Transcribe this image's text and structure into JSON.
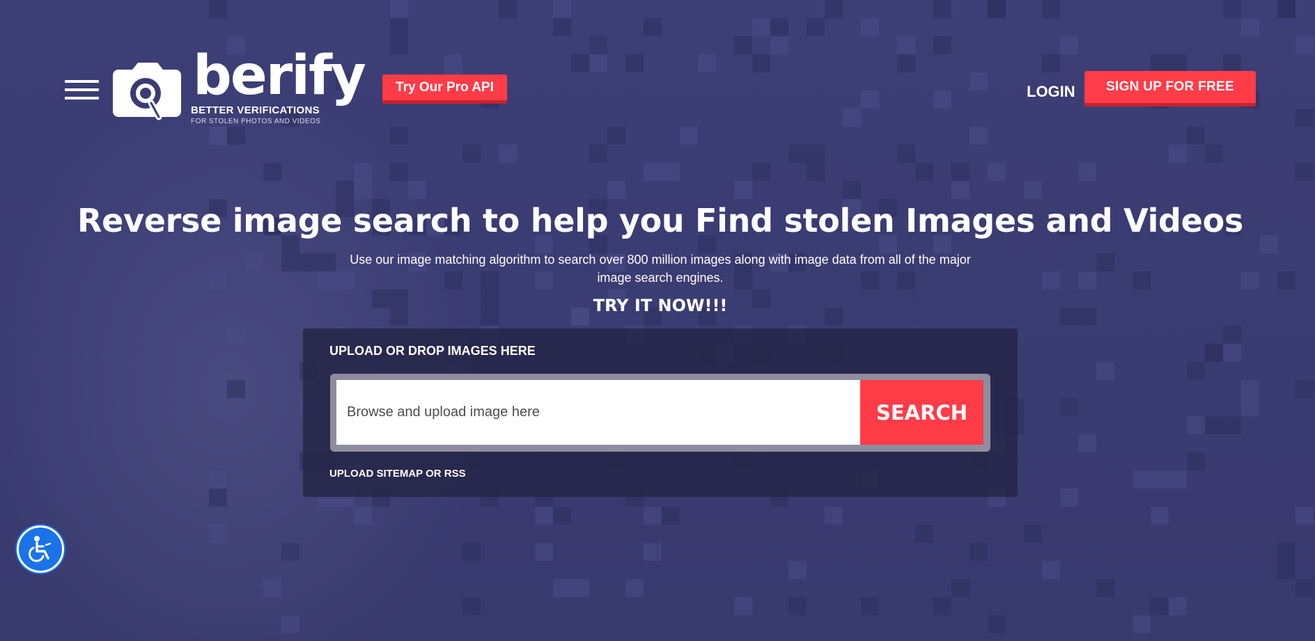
{
  "header": {
    "menu_icon": "hamburger-menu-icon",
    "logo": {
      "wordmark": "berify",
      "tagline": "BETTER VERIFICATIONS",
      "subtagline": "FOR STOLEN PHOTOS AND VIDEOS",
      "icon": "camera-magnifier-icon"
    },
    "api_button": "Try Our Pro API",
    "login": "LOGIN",
    "signup_button": "SIGN UP FOR FREE"
  },
  "hero": {
    "headline": "Reverse image search to help you Find stolen Images and Videos",
    "subtext": "Use our image matching algorithm to search over 800 million images along with image data from all of the major image search engines.",
    "cta": "TRY IT NOW!!!"
  },
  "upload": {
    "title": "UPLOAD OR DROP IMAGES HERE",
    "placeholder": "Browse and upload image here",
    "search_button": "SEARCH",
    "sitemap_link": "UPLOAD SITEMAP OR RSS"
  },
  "accessibility": {
    "icon": "accessibility-wheelchair-icon"
  },
  "colors": {
    "background": "#3b3c72",
    "accent_red": "#ff3c48",
    "accent_red_dark": "#c9222d",
    "panel": "#262648",
    "a11y_blue": "#1a73e8"
  }
}
